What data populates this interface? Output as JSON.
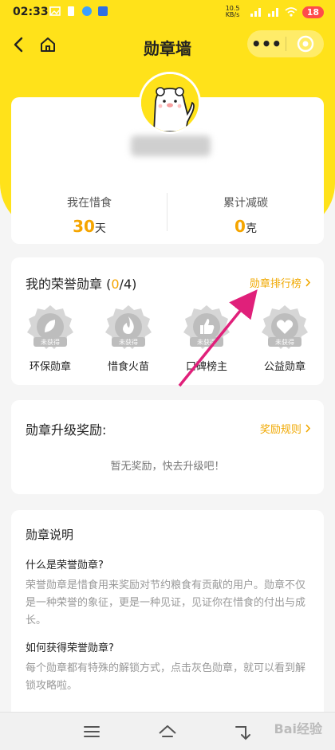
{
  "status_bar": {
    "time": "02:33",
    "network": "10.5 KB/s",
    "battery": "18"
  },
  "nav": {
    "title": "勋章墙",
    "more": "•••"
  },
  "profile": {
    "stat_days_label": "我在惜食",
    "stat_days_value": "30",
    "stat_days_unit": "天",
    "stat_carbon_label": "累计减碳",
    "stat_carbon_value": "0",
    "stat_carbon_unit": "克"
  },
  "badges": {
    "title": "我的荣誉勋章",
    "count_open": "(",
    "count_have": "0",
    "count_total": "/4)",
    "rank_link": "勋章排行榜",
    "unearned_tag": "未获得",
    "items": [
      {
        "label": "环保勋章",
        "icon": "leaf-icon"
      },
      {
        "label": "惜食火苗",
        "icon": "flame-icon"
      },
      {
        "label": "口碑榜主",
        "icon": "thumbs-up-icon"
      },
      {
        "label": "公益勋章",
        "icon": "heart-icon"
      }
    ]
  },
  "reward": {
    "title": "勋章升级奖励:",
    "rule_link": "奖励规则",
    "empty": "暂无奖励，快去升级吧！"
  },
  "desc": {
    "title": "勋章说明",
    "q1": "什么是荣誉勋章?",
    "a1": "荣誉勋章是惜食用来奖励对节约粮食有贡献的用户。勋章不仅是一种荣誉的象征，更是一种见证，见证你在惜食的付出与成长。",
    "q2": "如何获得荣誉勋章?",
    "a2": "每个勋章都有特殊的解锁方式，点击灰色勋章，就可以看到解锁攻略啦。"
  },
  "watermark": "Bai经验",
  "colors": {
    "brand_yellow": "#ffe21a",
    "accent_orange": "#f5a500",
    "annotation_arrow": "#e0207a"
  }
}
